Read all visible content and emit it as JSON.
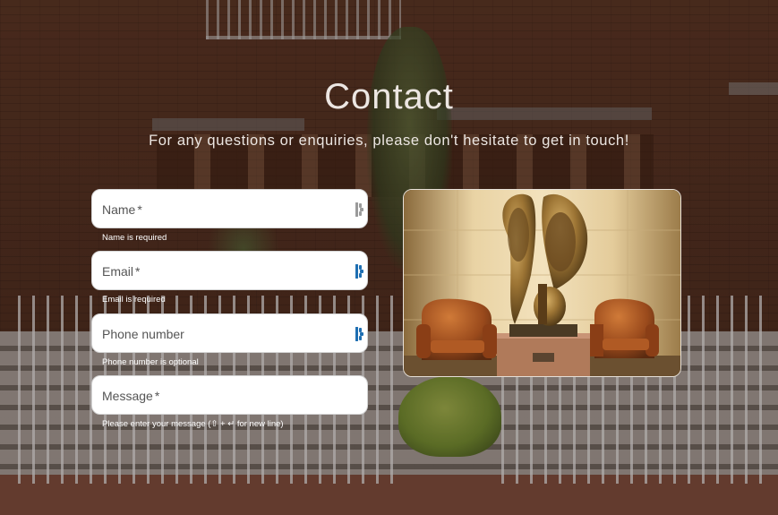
{
  "header": {
    "title": "Contact",
    "subtitle": "For any questions or enquiries, please don't hesitate to get in touch!"
  },
  "form": {
    "fields": [
      {
        "label": "Name",
        "required_mark": "*",
        "value": "",
        "helper": "Name is required",
        "has_autofill_icon": true
      },
      {
        "label": "Email",
        "required_mark": "*",
        "value": "",
        "helper": "Email is required",
        "has_autofill_icon": true
      },
      {
        "label": "Phone number",
        "required_mark": "",
        "value": "",
        "helper": "Phone number is optional",
        "has_autofill_icon": true
      },
      {
        "label": "Message",
        "required_mark": "*",
        "value": "",
        "helper": "Please enter your message (⇧ + ↵ for new line)",
        "has_autofill_icon": false
      }
    ]
  },
  "photo": {
    "icon": "lobby-sculpture-photo"
  },
  "colors": {
    "heading_text": "#ece6e2",
    "field_bg": "#ffffff",
    "field_label": "#555555",
    "helper_text": "#ffffff",
    "autofill_icon_active": "#1f6fb2",
    "autofill_icon_idle": "#9a9a9a"
  }
}
